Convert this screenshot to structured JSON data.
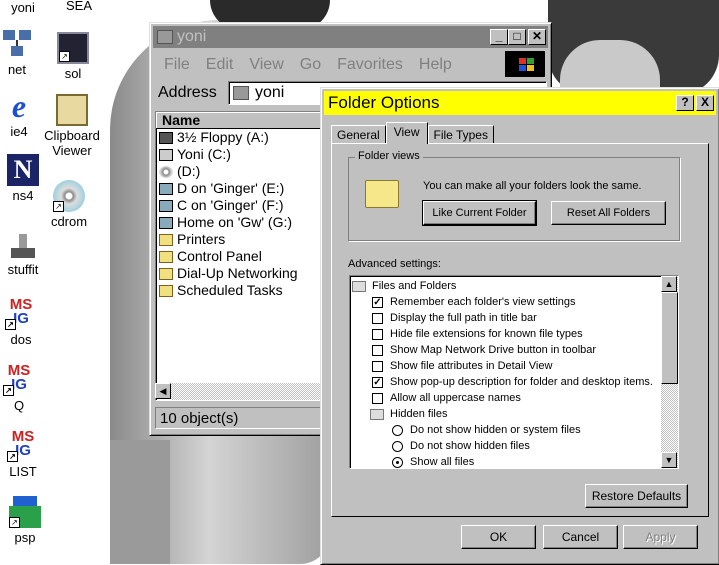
{
  "desktop": {
    "icons": [
      {
        "label": "yoni"
      },
      {
        "label": "SEA"
      },
      {
        "label": "net"
      },
      {
        "label": "sol"
      },
      {
        "label": "ie4"
      },
      {
        "label": "Clipboard Viewer"
      },
      {
        "label": "ns4"
      },
      {
        "label": "cdrom"
      },
      {
        "label": "stuffit"
      },
      {
        "label": "dos"
      },
      {
        "label": "Q"
      },
      {
        "label": "LIST"
      },
      {
        "label": "psp"
      }
    ],
    "ms_logo_top": "MS",
    "ms_logo_bottom": "IG",
    "ns_logo": "N",
    "ie_logo": "e"
  },
  "explorer": {
    "title": "yoni",
    "menu": [
      "File",
      "Edit",
      "View",
      "Go",
      "Favorites",
      "Help"
    ],
    "address_label": "Address",
    "address_value": "yoni",
    "column_header": "Name",
    "items": [
      {
        "name": "3½ Floppy (A:)",
        "icon": "floppy-icon"
      },
      {
        "name": "Yoni (C:)",
        "icon": "hard-drive-icon"
      },
      {
        "name": "(D:)",
        "icon": "cd-drive-icon"
      },
      {
        "name": "D on 'Ginger' (E:)",
        "icon": "network-drive-icon"
      },
      {
        "name": "C on 'Ginger' (F:)",
        "icon": "network-drive-icon"
      },
      {
        "name": "Home on 'Gw' (G:)",
        "icon": "network-drive-icon"
      },
      {
        "name": "Printers",
        "icon": "folder-icon"
      },
      {
        "name": "Control Panel",
        "icon": "folder-icon"
      },
      {
        "name": "Dial-Up Networking",
        "icon": "folder-icon"
      },
      {
        "name": "Scheduled Tasks",
        "icon": "folder-icon"
      }
    ],
    "status": "10 object(s)"
  },
  "folder_options": {
    "title": "Folder Options",
    "help_btn": "?",
    "close_btn": "X",
    "tabs": [
      "General",
      "View",
      "File Types"
    ],
    "active_tab": "View",
    "folder_views_label": "Folder views",
    "folder_views_text": "You can make all your folders look the same.",
    "like_current_btn": "Like Current Folder",
    "reset_all_btn": "Reset All Folders",
    "advanced_label": "Advanced settings:",
    "tree": {
      "group1": "Files and Folders",
      "checks": [
        {
          "label": "Remember each folder's view settings",
          "checked": true
        },
        {
          "label": "Display the full path in title bar",
          "checked": false
        },
        {
          "label": "Hide file extensions for known file types",
          "checked": false
        },
        {
          "label": "Show Map Network Drive button in toolbar",
          "checked": false
        },
        {
          "label": "Show file attributes in Detail View",
          "checked": false
        },
        {
          "label": "Show pop-up description for folder and desktop items.",
          "checked": true
        },
        {
          "label": "Allow all uppercase names",
          "checked": false
        }
      ],
      "group2": "Hidden files",
      "radios": [
        {
          "label": "Do not show hidden or system files",
          "selected": false
        },
        {
          "label": "Do not show hidden files",
          "selected": false
        },
        {
          "label": "Show all files",
          "selected": true
        }
      ]
    },
    "restore_btn": "Restore Defaults",
    "ok_btn": "OK",
    "cancel_btn": "Cancel",
    "apply_btn": "Apply"
  },
  "colors": {
    "dialog_title_bg": "#ffff00",
    "inactive_title_bg": "#808080",
    "face": "#c0c0c0"
  }
}
